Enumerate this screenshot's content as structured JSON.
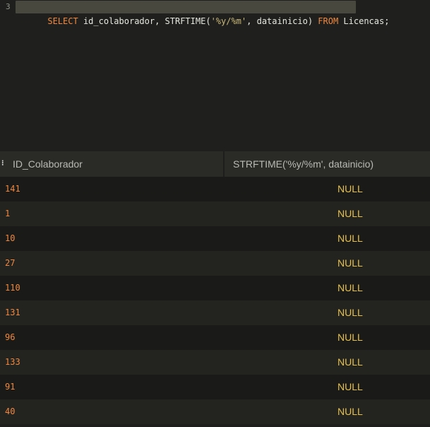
{
  "editor": {
    "line_number": "3",
    "tokens": [
      {
        "text": "SELECT",
        "kind": "kw"
      },
      {
        "text": " id_colaborador, STRFTIME(",
        "kind": "plain"
      },
      {
        "text": "'%y/%m'",
        "kind": "str"
      },
      {
        "text": ", datainicio) ",
        "kind": "plain"
      },
      {
        "text": "FROM",
        "kind": "kw"
      },
      {
        "text": " Licencas;",
        "kind": "plain"
      }
    ]
  },
  "results": {
    "row_marker": "⁝",
    "columns": [
      "ID_Colaborador",
      "STRFTIME('%y/%m', datainicio)"
    ],
    "rows": [
      {
        "id": "141",
        "value": "NULL"
      },
      {
        "id": "1",
        "value": "NULL"
      },
      {
        "id": "10",
        "value": "NULL"
      },
      {
        "id": "27",
        "value": "NULL"
      },
      {
        "id": "110",
        "value": "NULL"
      },
      {
        "id": "131",
        "value": "NULL"
      },
      {
        "id": "96",
        "value": "NULL"
      },
      {
        "id": "133",
        "value": "NULL"
      },
      {
        "id": "91",
        "value": "NULL"
      },
      {
        "id": "40",
        "value": "NULL"
      }
    ]
  },
  "colors": {
    "keyword": "#f0883e",
    "string": "#c9b77a",
    "null_value": "#e6c04a",
    "id_value": "#f0883e"
  }
}
